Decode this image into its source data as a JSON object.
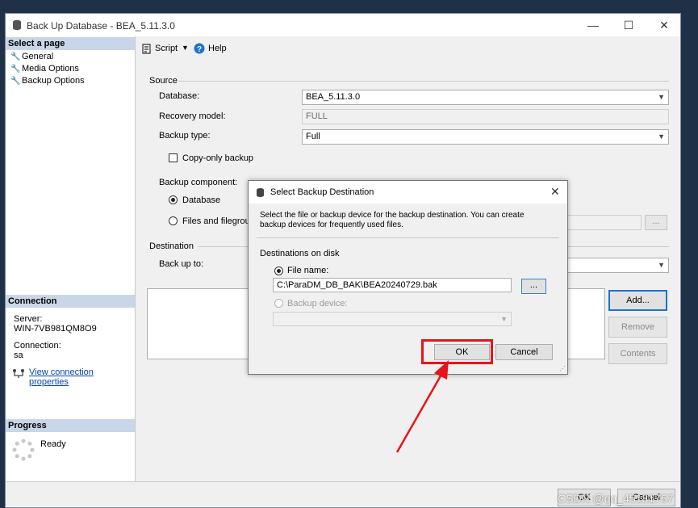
{
  "window": {
    "title": "Back Up Database - BEA_5.11.3.0",
    "minimize": "—",
    "maximize": "☐",
    "close": "✕"
  },
  "sidebar": {
    "select_page_header": "Select a page",
    "pages": [
      {
        "label": "General"
      },
      {
        "label": "Media Options"
      },
      {
        "label": "Backup Options"
      }
    ],
    "connection_header": "Connection",
    "server_label": "Server:",
    "server_value": "WIN-7VB981QM8O9",
    "connection_label": "Connection:",
    "connection_value": "sa",
    "view_link": "View connection properties",
    "progress_header": "Progress",
    "progress_status": "Ready"
  },
  "toolbar": {
    "script_label": "Script",
    "help_label": "Help"
  },
  "source": {
    "group_label": "Source",
    "database_label": "Database:",
    "database_value": "BEA_5.11.3.0",
    "recovery_label": "Recovery model:",
    "recovery_value": "FULL",
    "backup_type_label": "Backup type:",
    "backup_type_value": "Full",
    "copy_only_label": "Copy-only backup",
    "component_label": "Backup component:",
    "database_radio": "Database",
    "files_radio": "Files and filegroups:",
    "browse_label": "..."
  },
  "destination": {
    "group_label": "Destination",
    "back_up_to_label": "Back up to:",
    "add_button": "Add...",
    "remove_button": "Remove",
    "contents_button": "Contents"
  },
  "dialog": {
    "title": "Select Backup Destination",
    "close": "✕",
    "description": "Select the file or backup device for the backup destination. You can create backup devices for frequently used files.",
    "destinations_label": "Destinations on disk",
    "file_name_label": "File name:",
    "file_name_value": "C:\\ParaDM_DB_BAK\\BEA20240729.bak",
    "browse_label": "...",
    "backup_device_label": "Backup device:",
    "ok_button": "OK",
    "cancel_button": "Cancel"
  },
  "footer": {
    "ok_button": "OK",
    "cancel_button": "Cancel",
    "watermark": "CSDN @qq_45181767"
  },
  "colors": {
    "highlight": "#e8141b",
    "section_header": "#c9d6e8",
    "link": "#0645ad"
  }
}
